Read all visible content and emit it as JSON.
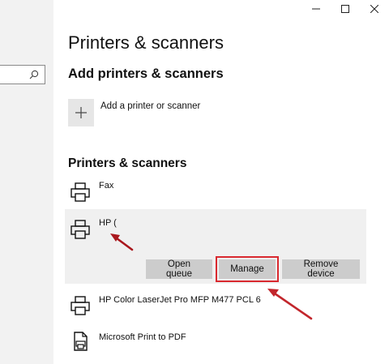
{
  "window": {
    "minimize_icon": "minimize-icon",
    "maximize_icon": "maximize-icon",
    "close_icon": "close-icon"
  },
  "search": {
    "placeholder": "",
    "icon": "search-icon"
  },
  "page": {
    "title": "Printers & scanners"
  },
  "add_section": {
    "heading": "Add printers & scanners",
    "add_label": "Add a printer or scanner",
    "add_icon": "plus-icon"
  },
  "list_section": {
    "heading": "Printers & scanners",
    "printers": [
      {
        "name": "Fax",
        "icon": "printer-icon"
      },
      {
        "name": "HP (",
        "icon": "printer-icon"
      },
      {
        "name": "HP Color LaserJet Pro MFP M477 PCL 6",
        "icon": "printer-icon"
      },
      {
        "name": "Microsoft Print to PDF",
        "icon": "pdf-printer-icon"
      }
    ],
    "actions": {
      "open_queue": "Open queue",
      "manage": "Manage",
      "remove_device": "Remove device"
    }
  },
  "colors": {
    "annotation_red": "#d9292f",
    "selected_row_bg": "#f0f0f0",
    "button_bg": "#cccccc"
  }
}
